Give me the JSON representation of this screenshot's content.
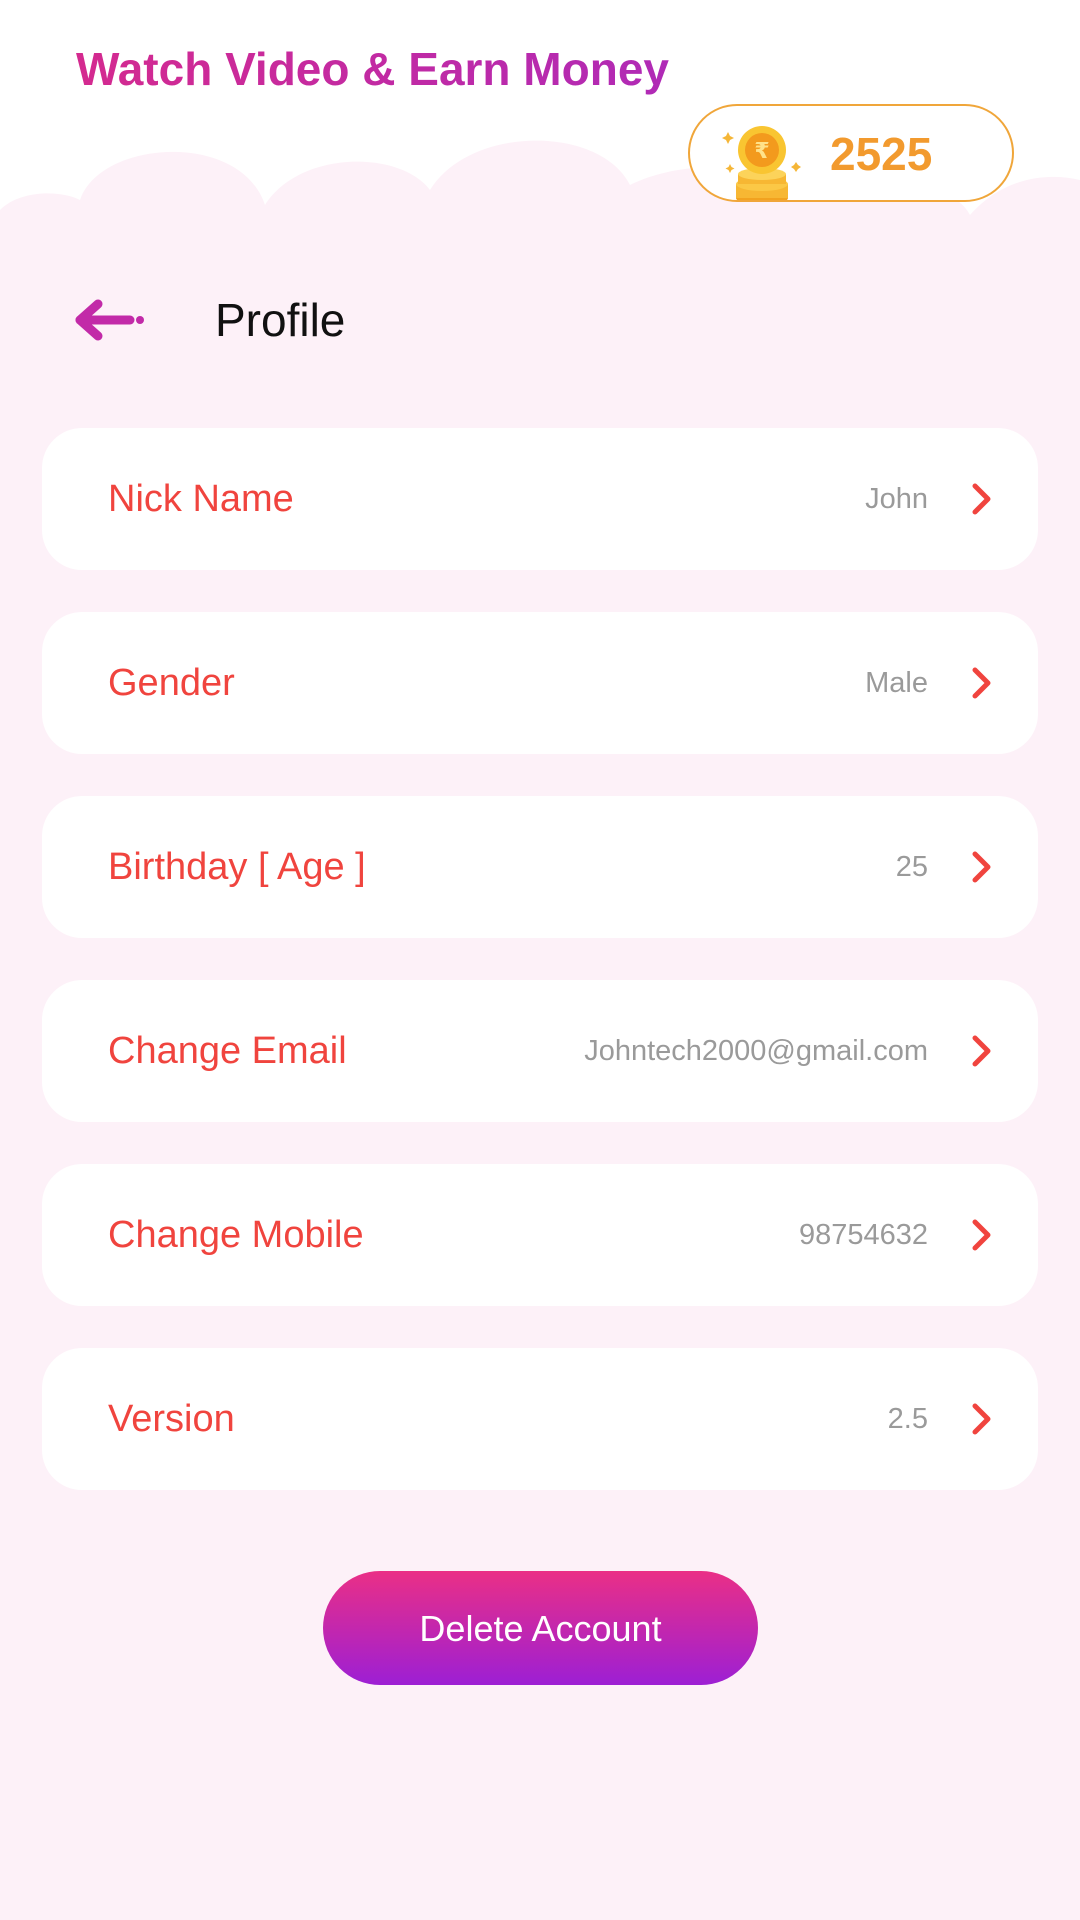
{
  "app": {
    "title": "Watch Video & Earn Money"
  },
  "coins": {
    "count": "2525",
    "icon": "rupee-coin-stack-icon"
  },
  "header": {
    "back_icon": "arrow-left-icon",
    "title": "Profile"
  },
  "profile_items": [
    {
      "label": "Nick Name",
      "value": "John"
    },
    {
      "label": "Gender",
      "value": "Male"
    },
    {
      "label": "Birthday [ Age ]",
      "value": "25"
    },
    {
      "label": "Change Email",
      "value": "Johntech2000@gmail.com"
    },
    {
      "label": "Change Mobile",
      "value": "98754632"
    },
    {
      "label": "Version",
      "value": "2.5"
    }
  ],
  "actions": {
    "delete_label": "Delete Account"
  },
  "colors": {
    "label": "#f0443e",
    "value": "#9a9a9a",
    "accent_pink": "#d42a8f",
    "accent_purple": "#9d1fd4",
    "coin_orange": "#f29a2e",
    "background": "#fdf1f8"
  }
}
